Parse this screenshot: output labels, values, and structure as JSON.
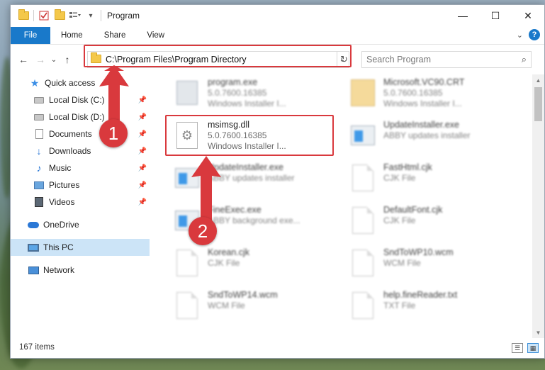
{
  "window": {
    "title": "Program",
    "controls": {
      "minimize": "—",
      "maximize": "☐",
      "close": "✕"
    }
  },
  "ribbon": {
    "tabs": [
      "File",
      "Home",
      "Share",
      "View"
    ],
    "expand_icon": "chevron-down-icon",
    "help_icon": "?"
  },
  "nav": {
    "back": "←",
    "forward": "→",
    "recent": "⌄",
    "up": "↑"
  },
  "address": {
    "path": "C:\\Program Files\\Program Directory",
    "dropdown": "⌄",
    "refresh": "↻"
  },
  "search": {
    "placeholder": "Search Program",
    "icon": "⌕"
  },
  "sidebar": {
    "items": [
      {
        "label": "Quick access",
        "icon": "star-icon"
      },
      {
        "label": "Local Disk (C:)",
        "icon": "drive-icon",
        "pinned": true
      },
      {
        "label": "Local Disk (D:)",
        "icon": "drive-icon",
        "pinned": true
      },
      {
        "label": "Documents",
        "icon": "documents-icon",
        "pinned": true
      },
      {
        "label": "Downloads",
        "icon": "downloads-icon",
        "pinned": true
      },
      {
        "label": "Music",
        "icon": "music-icon",
        "pinned": true
      },
      {
        "label": "Pictures",
        "icon": "pictures-icon",
        "pinned": true
      },
      {
        "label": "Videos",
        "icon": "videos-icon",
        "pinned": true
      },
      {
        "label": "OneDrive",
        "icon": "onedrive-icon"
      },
      {
        "label": "This PC",
        "icon": "this-pc-icon",
        "selected": true
      },
      {
        "label": "Network",
        "icon": "network-icon"
      }
    ],
    "pin_glyph": "📌"
  },
  "files": [
    {
      "name": "program.exe",
      "line1": "5.0.7600.16385",
      "line2": "Windows Installer I...",
      "icon": "exe-icon",
      "blurred": true
    },
    {
      "name": "Microsoft.VC90.CRT",
      "line1": "5.0.7600.16385",
      "line2": "Windows Installer I...",
      "icon": "folder-icon",
      "blurred": true
    },
    {
      "name": "msimsg.dll",
      "line1": "5.0.7600.16385",
      "line2": "Windows Installer I...",
      "icon": "dll-gear-icon",
      "blurred": false
    },
    {
      "name": "UpdateInstaller.exe",
      "line1": "ABBY updates installer",
      "line2": "",
      "icon": "app-icon",
      "blurred": true
    },
    {
      "name": "UpdateInstaller.exe",
      "line1": "ABBY updates installer",
      "line2": "",
      "icon": "app-icon",
      "blurred": true
    },
    {
      "name": "FastHtml.cjk",
      "line1": "CJK File",
      "line2": "",
      "icon": "page-icon",
      "blurred": true
    },
    {
      "name": "FineExec.exe",
      "line1": "ABBY background exe...",
      "line2": "",
      "icon": "app-icon",
      "blurred": true
    },
    {
      "name": "DefaultFont.cjk",
      "line1": "CJK File",
      "line2": "",
      "icon": "page-icon",
      "blurred": true
    },
    {
      "name": "Korean.cjk",
      "line1": "CJK File",
      "line2": "",
      "icon": "page-icon",
      "blurred": true
    },
    {
      "name": "SndToWP10.wcm",
      "line1": "WCM File",
      "line2": "",
      "icon": "page-icon",
      "blurred": true
    },
    {
      "name": "SndToWP14.wcm",
      "line1": "WCM File",
      "line2": "",
      "icon": "page-icon",
      "blurred": true
    },
    {
      "name": "help.fineReader.txt",
      "line1": "TXT File",
      "line2": "",
      "icon": "page-icon",
      "blurred": true
    }
  ],
  "status": {
    "count": "167 items"
  },
  "annotations": {
    "step1": "1",
    "step2": "2",
    "highlight_color": "#d9393d"
  }
}
